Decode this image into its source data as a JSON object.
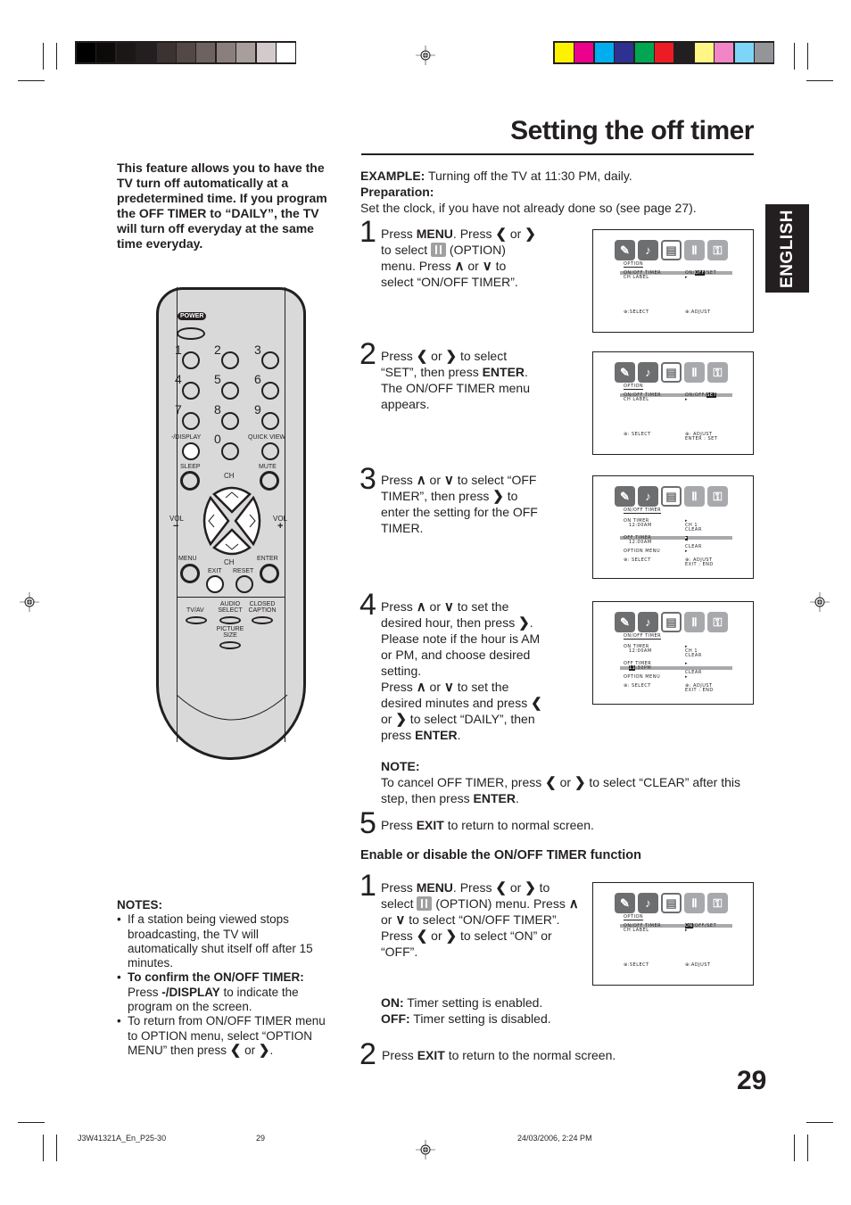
{
  "page": {
    "title": "Setting the off timer",
    "page_number": "29",
    "language_tab": "ENGLISH",
    "color_bar_grays": [
      "#000000",
      "#0d0b0a",
      "#1a1716",
      "#231f20",
      "#3b3331",
      "#534846",
      "#6d6260",
      "#8a7f7d",
      "#a89f9d",
      "#d3cbcb",
      "#ffffff"
    ],
    "color_bar_colors": [
      "#fff200",
      "#ec008c",
      "#00aeef",
      "#2e3192",
      "#00a651",
      "#ed1c24",
      "#231f20",
      "#fff685",
      "#f285c5",
      "#7dd6f7",
      "#939598"
    ]
  },
  "intro": "This feature allows you to have the TV turn off automatically at a predetermined time. If you program the OFF TIMER to “DAILY”, the TV will turn off everyday at the same time everyday.",
  "example": {
    "label": "EXAMPLE:",
    "text": " Turning off the TV at 11:30 PM, daily.",
    "prep_label": "Preparation:",
    "prep_text": "Set the clock, if you have not already done so (see page 27)."
  },
  "steps": [
    {
      "num": "1",
      "parts": {
        "a": "Press ",
        "b": "MENU",
        "c": ". Press ",
        "d": " or ",
        "e": "to select ",
        "f": " (OPTION) menu. Press ",
        "g": " or ",
        "h": " to select “ON/OFF TIMER”."
      }
    },
    {
      "num": "2",
      "parts": {
        "a": "Press ",
        "b": " or ",
        "c": "  to select “SET”, then press ",
        "d": "ENTER",
        "e": ". The ON/OFF TIMER menu appears."
      }
    },
    {
      "num": "3",
      "parts": {
        "a": "Press ",
        "b": " or ",
        "c": " to select “OFF TIMER”, then press ",
        "d": " to enter the setting for the OFF TIMER."
      }
    },
    {
      "num": "4",
      "parts": {
        "a": "Press ",
        "b": " or ",
        "c": " to set the desired hour, then press ",
        "d": ". Please note if the hour is AM or PM, and choose desired setting.",
        "e": "Press ",
        "f": " or ",
        "g": " to set the desired minutes and press ",
        "h": " or ",
        "i": " to select “DAILY”, then press ",
        "j": "ENTER",
        "k": "."
      }
    },
    {
      "num": "5",
      "parts": {
        "a": "Press ",
        "b": "EXIT",
        "c": " to return to normal screen."
      }
    }
  ],
  "note": {
    "label": "NOTE:",
    "a": "To cancel OFF  TIMER, press ",
    "b": " or ",
    "c": " to select “CLEAR” after this step, then press ",
    "d": "ENTER",
    "e": "."
  },
  "enable_section": {
    "heading": "Enable or disable the ON/OFF TIMER function",
    "step1": {
      "num": "1",
      "a": "Press ",
      "b": "MENU",
      "c": ". Press ",
      "d": " or ",
      "e": "  to select ",
      "f": " (OPTION) menu. Press ",
      "g": " or ",
      "h": " to select “ON/OFF TIMER”.",
      "i": "Press ",
      "j": " or ",
      "k": "  to select “ON” or “OFF”."
    },
    "on_label": "ON:",
    "on_text": "   Timer setting is enabled.",
    "off_label": "OFF:",
    "off_text": " Timer setting is disabled.",
    "step2": {
      "num": "2",
      "a": "Press ",
      "b": "EXIT",
      "c": " to return to the normal screen."
    }
  },
  "glyphs": {
    "left": "❮",
    "right": "❯",
    "up": "∧",
    "down": "∨"
  },
  "screens": [
    {
      "header": "OPTION",
      "row1_label": "ON/OFF TIMER",
      "row1_pre": "ON/",
      "row1_sel": "OFF",
      "row1_post": "/SET",
      "row2_label": "CH LABEL",
      "row2_val": "▸",
      "foot_left": "⊕:SELECT",
      "foot_right": "⊕:ADJUST",
      "foot_right2": ""
    },
    {
      "header": "OPTION",
      "row1_label": "ON/OFF TIMER",
      "row1_pre": "ON/OFF/",
      "row1_sel": "SET",
      "row1_post": "",
      "row2_label": "CH LABEL",
      "row2_val": "▸",
      "foot_left": "⊕: SELECT",
      "foot_right": "⊕: ADJUST",
      "foot_right2": "ENTER : SET"
    },
    {
      "header": "ON/OFF TIMER",
      "on_timer": "ON TIMER",
      "on_time": "12:00AM",
      "on_v1": "▸",
      "on_v2": "CH    1",
      "on_v3": "CLEAR",
      "off_timer": "OFF TIMER",
      "off_time": "12:00AM",
      "off_v1": "▸",
      "off_v3": "CLEAR",
      "option_menu": "OPTION MENU",
      "option_val": "▸",
      "foot_left": "⊕: SELECT",
      "foot_right": "⊕: ADJUST",
      "foot_right2": "EXIT : END"
    },
    {
      "header": "ON/OFF TIMER",
      "on_timer": "ON TIMER",
      "on_time": "12:00AM",
      "on_v1": "▸",
      "on_v2": "CH    1",
      "on_v3": "CLEAR",
      "off_timer": "OFF TIMER",
      "off_time_sel": "11",
      "off_time": ":30PM",
      "off_v1": "▸",
      "off_v3": "CLEAR",
      "option_menu": "OPTION MENU",
      "option_val": "▸",
      "foot_left": "⊕: SELECT",
      "foot_right": "⊕: ADJUST",
      "foot_right2": "EXIT : END"
    },
    {
      "header": "OPTION",
      "row1_label": "ON/OFF TIMER",
      "row1_pre": "",
      "row1_sel": "ON",
      "row1_post": "/OFF/SET",
      "row2_label": "CH LABEL",
      "row2_val": "▸",
      "foot_left": "⊕:SELECT",
      "foot_right": "⊕:ADJUST",
      "foot_right2": ""
    }
  ],
  "screen_icons": [
    "✎",
    "♪",
    "▤",
    "Ⅱ",
    "⚿"
  ],
  "remote": {
    "power": "POWER",
    "numbers": [
      "1",
      "2",
      "3",
      "4",
      "5",
      "6",
      "7",
      "8",
      "9",
      "0"
    ],
    "display": "-/DISPLAY",
    "quick_view": "QUICK VIEW",
    "sleep": "SLEEP",
    "mute": "MUTE",
    "ch": "CH",
    "vol": "VOL",
    "vol_minus": "−",
    "vol_plus": "+",
    "menu": "MENU",
    "enter": "ENTER",
    "exit": "EXIT",
    "reset": "RESET",
    "tv_av": "TV/AV",
    "audio_select": "AUDIO SELECT",
    "closed_caption": "CLOSED CAPTION",
    "picture_size": "PICTURE SIZE"
  },
  "notes": {
    "label": "NOTES:",
    "item1": "If a station being viewed stops broadcasting, the TV will automatically shut itself off after 15 minutes.",
    "item2_bold": "To confirm the ON/OFF TIMER:",
    "item2_a": " Press ",
    "item2_b": "-/DISPLAY",
    "item2_c": " to indicate the program on the screen.",
    "item3_a": "To return from ON/OFF TIMER menu to OPTION menu, select “OPTION MENU” then press ",
    "item3_b": " or ",
    "item3_c": "."
  },
  "footer": {
    "file": "J3W41321A_En_P25-30",
    "page": "29",
    "datetime": "24/03/2006, 2:24 PM"
  }
}
